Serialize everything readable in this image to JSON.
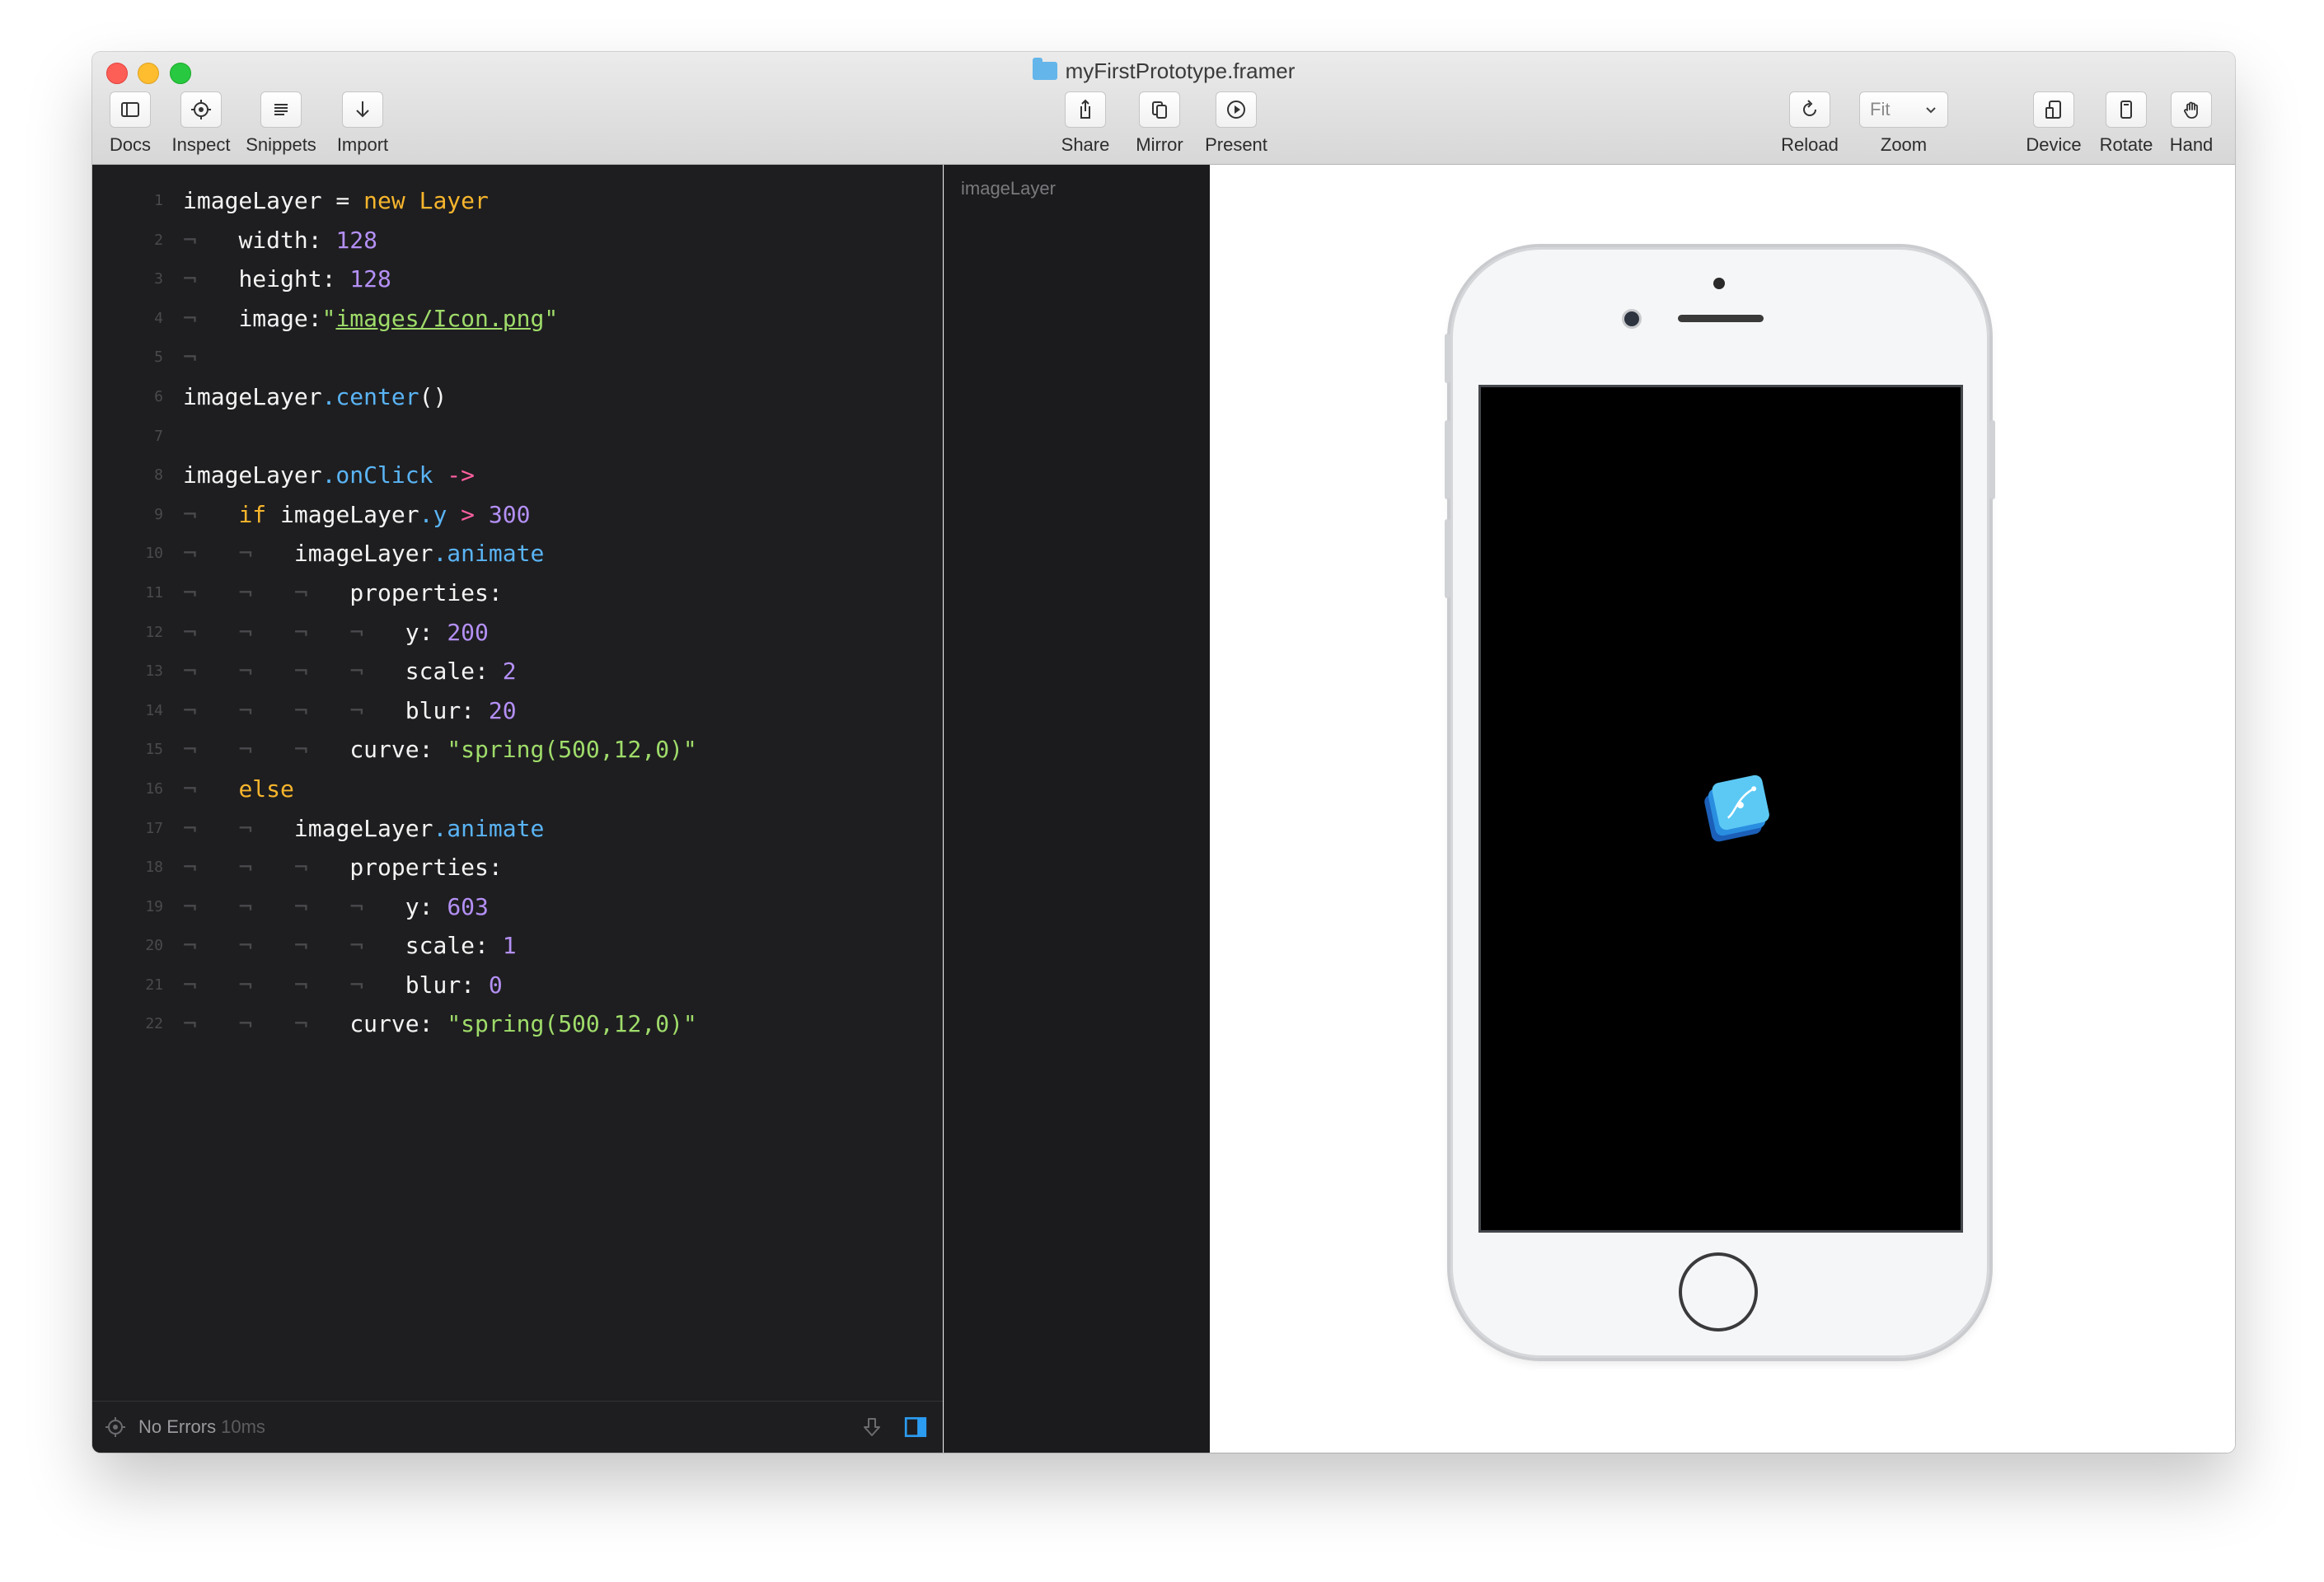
{
  "window": {
    "title": "myFirstPrototype.framer"
  },
  "toolbar": {
    "docs": "Docs",
    "inspect": "Inspect",
    "snippets": "Snippets",
    "import": "Import",
    "share": "Share",
    "mirror": "Mirror",
    "present": "Present",
    "reload": "Reload",
    "zoom_value": "Fit",
    "zoom": "Zoom",
    "device": "Device",
    "rotate": "Rotate",
    "hand": "Hand"
  },
  "editor": {
    "line_numbers": [
      "1",
      "2",
      "3",
      "4",
      "5",
      "6",
      "7",
      "8",
      "9",
      "10",
      "11",
      "12",
      "13",
      "14",
      "15",
      "16",
      "17",
      "18",
      "19",
      "20",
      "21",
      "22"
    ],
    "code": {
      "l1": {
        "a": "imageLayer",
        "b": " = ",
        "c": "new",
        "d": " ",
        "e": "Layer"
      },
      "l2": {
        "a": "width:",
        "b": " ",
        "c": "128"
      },
      "l3": {
        "a": "height:",
        "b": " ",
        "c": "128"
      },
      "l4": {
        "a": "image:",
        "b": "\"",
        "c": "images/Icon.png",
        "d": "\""
      },
      "l6": {
        "a": "imageLayer",
        "b": ".center",
        "c": "()"
      },
      "l8": {
        "a": "imageLayer",
        "b": ".onClick",
        "c": " ",
        "d": "->"
      },
      "l9": {
        "a": "if",
        "b": " imageLayer",
        "c": ".y",
        "d": " ",
        "e": ">",
        "f": " ",
        "g": "300"
      },
      "l10": {
        "a": "imageLayer",
        "b": ".animate"
      },
      "l11": {
        "a": "properties:"
      },
      "l12": {
        "a": "y:",
        "b": " ",
        "c": "200"
      },
      "l13": {
        "a": "scale:",
        "b": " ",
        "c": "2"
      },
      "l14": {
        "a": "blur:",
        "b": " ",
        "c": "20"
      },
      "l15": {
        "a": "curve:",
        "b": " ",
        "c": "\"spring(500,12,0)\""
      },
      "l16": {
        "a": "else"
      },
      "l17": {
        "a": "imageLayer",
        "b": ".animate"
      },
      "l18": {
        "a": "properties:"
      },
      "l19": {
        "a": "y:",
        "b": " ",
        "c": "603"
      },
      "l20": {
        "a": "scale:",
        "b": " ",
        "c": "1"
      },
      "l21": {
        "a": "blur:",
        "b": " ",
        "c": "0"
      },
      "l22": {
        "a": "curve:",
        "b": " ",
        "c": "\"spring(500,12,0)\""
      }
    },
    "indent_marker": "¬"
  },
  "status": {
    "text": "No Errors",
    "time": "10ms"
  },
  "layers": {
    "items": [
      "imageLayer"
    ]
  },
  "colors": {
    "editor_bg": "#1e1e20",
    "keyword": "#f7b52c",
    "method": "#5ab4f5",
    "number": "#b490f5",
    "string": "#9fdc6a",
    "operator": "#ff5fa0",
    "accent": "#2c9cf0"
  },
  "icons": {
    "docs": "sidebar-icon",
    "inspect": "crosshair-icon",
    "snippets": "list-icon",
    "import": "arrow-down-icon",
    "share": "share-icon",
    "mirror": "mirror-icon",
    "present": "play-icon",
    "reload": "reload-icon",
    "device": "device-icon",
    "rotate": "rotate-icon",
    "hand": "hand-icon"
  }
}
